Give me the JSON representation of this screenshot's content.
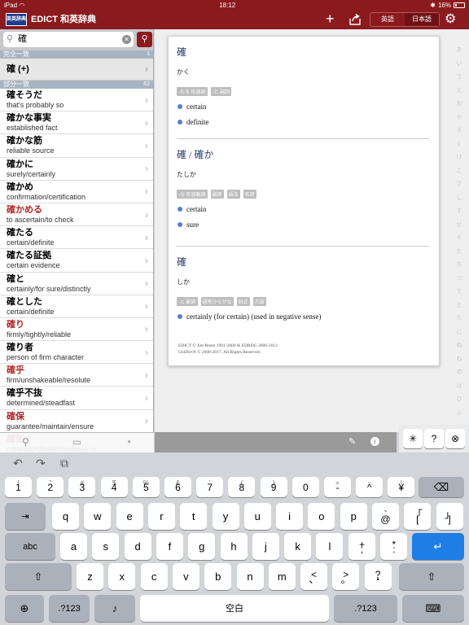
{
  "status_bar": {
    "device": "iPad",
    "wifi_icon": "wifi-icon",
    "time": "18:12",
    "battery_percent": "16%"
  },
  "nav": {
    "logo_text": "英英辞典",
    "title": "EDICT 和英辞典",
    "plus_label": "+",
    "segments": [
      "英語",
      "日本語"
    ],
    "selected_segment": 1
  },
  "search": {
    "query": "確",
    "clear_icon": "clear-icon",
    "search_icon": "search-icon"
  },
  "sidebar": {
    "exact_header": "完全一致",
    "exact_count": "1",
    "exact_item": "確 (+)",
    "partial_header": "部分一致",
    "partial_count": "62",
    "rows": [
      {
        "word": "確そうだ",
        "def": "that's probably so",
        "red": false
      },
      {
        "word": "確かな事実",
        "def": "established fact",
        "red": false
      },
      {
        "word": "確かな筋",
        "def": "reliable source",
        "red": false
      },
      {
        "word": "確かに",
        "def": "surely/certainly",
        "red": false
      },
      {
        "word": "確かめ",
        "def": "confirmation/certification",
        "red": false
      },
      {
        "word": "確かめる",
        "def": "to ascertain/to check",
        "red": true
      },
      {
        "word": "確たる",
        "def": "certain/definite",
        "red": false
      },
      {
        "word": "確たる証拠",
        "def": "certain evidence",
        "red": false
      },
      {
        "word": "確と",
        "def": "certainly/for sure/distinctly",
        "red": false
      },
      {
        "word": "確とした",
        "def": "certain/definite",
        "red": false
      },
      {
        "word": "確り",
        "def": "firmly/tightly/reliable",
        "red": true
      },
      {
        "word": "確り者",
        "def": "person of firm character",
        "red": false
      },
      {
        "word": "確乎",
        "def": "firm/unshakeable/resolute",
        "red": true
      },
      {
        "word": "確乎不抜",
        "def": "determined/steadfast",
        "red": false
      },
      {
        "word": "確保",
        "def": "guarantee/maintain/ensure",
        "red": true
      },
      {
        "word": "確信",
        "def": "conviction/belief/confidence",
        "red": true
      }
    ]
  },
  "detail": {
    "entries": [
      {
        "headword": "確",
        "reading": "かく",
        "tags": [
          "-たる 形容詞",
          "-と 副詞"
        ],
        "defs": [
          "certain",
          "definite"
        ]
      },
      {
        "headword": "確 / 確か",
        "reading": "たしか",
        "tags": [
          "-な 形容動詞",
          "副詞",
          "語法",
          "名詞"
        ],
        "defs": [
          "certain",
          "sure"
        ]
      },
      {
        "headword": "確",
        "reading": "しか",
        "tags": [
          "-と 副詞",
          "通常ひらがな",
          "旧式",
          "古語"
        ],
        "defs": [
          "certainly (for certain) (used in negative sense)"
        ]
      }
    ],
    "credit_line1": "EDICT © Jim Breen 1991-2000 & EDRDG 2000-2012",
    "credit_line2": "UniDict® © 2008-2017, All Rights Reserved.",
    "index_letters": [
      "あ",
      "い",
      "う",
      "え",
      "お",
      "か",
      "き",
      "く",
      "け",
      "こ",
      "さ",
      "し",
      "す",
      "せ",
      "そ",
      "た",
      "ち",
      "つ",
      "て",
      "と",
      "な",
      "に",
      "ぬ",
      "ね",
      "の",
      "は",
      "ひ",
      "ふ"
    ]
  },
  "keyboard": {
    "assist": {
      "undo_icon": "undo-icon",
      "redo_icon": "redo-icon",
      "paste_icon": "paste-icon"
    },
    "popover": {
      "asterisk": "✳",
      "help": "?",
      "close_icon": "close-circle-icon"
    },
    "number_row": [
      {
        "sym": "!",
        "main": "1"
      },
      {
        "sym": "\"",
        "main": "2"
      },
      {
        "sym": "#",
        "main": "3"
      },
      {
        "sym": "$",
        "main": "4"
      },
      {
        "sym": "%",
        "main": "5"
      },
      {
        "sym": "&",
        "main": "6"
      },
      {
        "sym": "'",
        "main": "7"
      },
      {
        "sym": "(",
        "main": "8"
      },
      {
        "sym": ")",
        "main": "9"
      },
      {
        "sym": "",
        "main": "0"
      },
      {
        "sym": "=",
        "main": "-"
      },
      {
        "sym": "~",
        "main": "^"
      },
      {
        "sym": "|",
        "main": "¥"
      }
    ],
    "qwerty_row": [
      "q",
      "w",
      "e",
      "r",
      "t",
      "y",
      "u",
      "i",
      "o",
      "p"
    ],
    "qwerty_extra": [
      {
        "top": "`",
        "bot": "@"
      },
      {
        "top": "「",
        "bot": "["
      },
      {
        "top": "」",
        "bot": "]"
      }
    ],
    "asdf_row": [
      "a",
      "s",
      "d",
      "f",
      "g",
      "h",
      "j",
      "k",
      "l"
    ],
    "asdf_extra": [
      {
        "top": "+",
        "bot": ";"
      },
      {
        "top": "*",
        "bot": ":"
      }
    ],
    "zxcv_row": [
      "z",
      "x",
      "c",
      "v",
      "b",
      "n",
      "m"
    ],
    "zxcv_extra": [
      {
        "top": "<",
        "bot": "、"
      },
      {
        "top": ">",
        "bot": "。"
      },
      {
        "top": "?",
        "bot": "・"
      }
    ],
    "tab_label": "⇥",
    "caps_label": "abc",
    "numbers_label": ".?123",
    "space_label": "空白",
    "backspace_icon": "backspace-icon",
    "return_icon": "return-icon",
    "shift_icon": "shift-icon",
    "globe_icon": "globe-icon",
    "mic_icon": "microphone-icon",
    "hide_keyboard_icon": "keyboard-dismiss-icon"
  }
}
